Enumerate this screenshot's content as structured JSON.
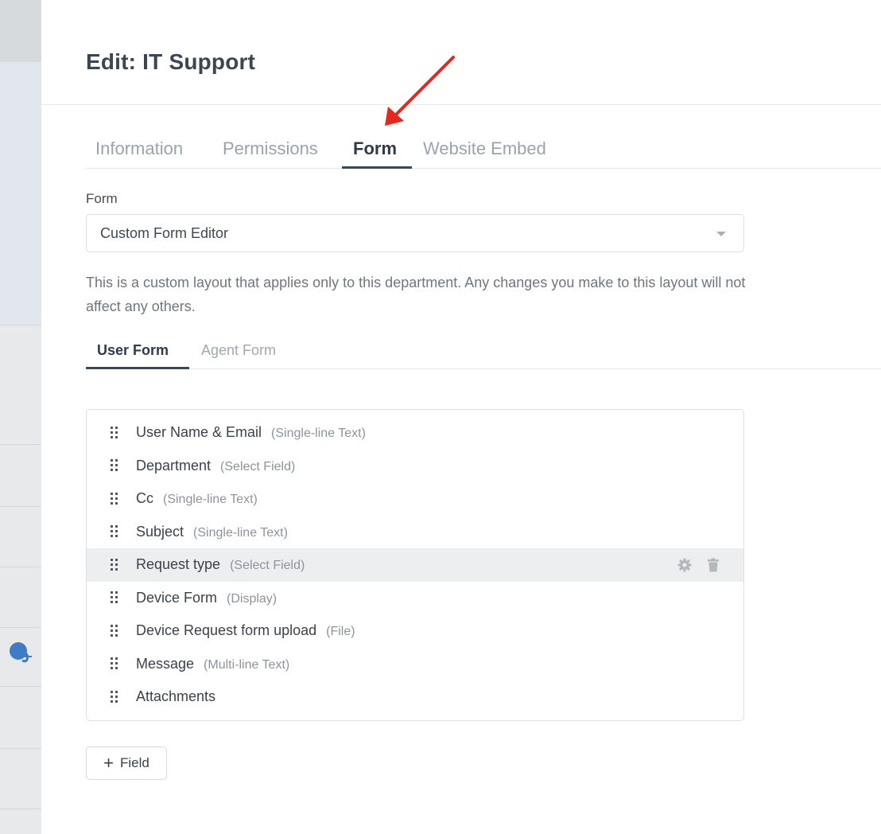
{
  "header": {
    "title": "Edit: IT Support"
  },
  "main_tabs": [
    {
      "label": "Information",
      "active": false
    },
    {
      "label": "Permissions",
      "active": false
    },
    {
      "label": "Form",
      "active": true
    },
    {
      "label": "Website Embed",
      "active": false
    }
  ],
  "form_section": {
    "label": "Form",
    "select_value": "Custom Form Editor",
    "description": "This is a custom layout that applies only to this department. Any changes you make to this layout will not affect any others."
  },
  "sub_tabs": [
    {
      "label": "User Form",
      "active": true
    },
    {
      "label": "Agent Form",
      "active": false
    }
  ],
  "fields": [
    {
      "name": "User Name & Email",
      "type": "(Single-line Text)"
    },
    {
      "name": "Department",
      "type": "(Select Field)"
    },
    {
      "name": "Cc",
      "type": "(Single-line Text)"
    },
    {
      "name": "Subject",
      "type": "(Single-line Text)"
    },
    {
      "name": "Request type",
      "type": "(Select Field)",
      "hovered": true
    },
    {
      "name": "Device Form",
      "type": "(Display)"
    },
    {
      "name": "Device Request form upload",
      "type": "(File)"
    },
    {
      "name": "Message",
      "type": "(Multi-line Text)"
    },
    {
      "name": "Attachments",
      "type": ""
    }
  ],
  "add_field_button": {
    "icon": "plus-icon",
    "label": "Field"
  },
  "icons": {
    "row_settings": "gear-icon",
    "row_delete": "trash-icon",
    "drag": "drag-handle-icon"
  },
  "colors": {
    "accent": "#35495c",
    "annotation_arrow": "#e8261c",
    "row_hover": "#edeef0"
  }
}
